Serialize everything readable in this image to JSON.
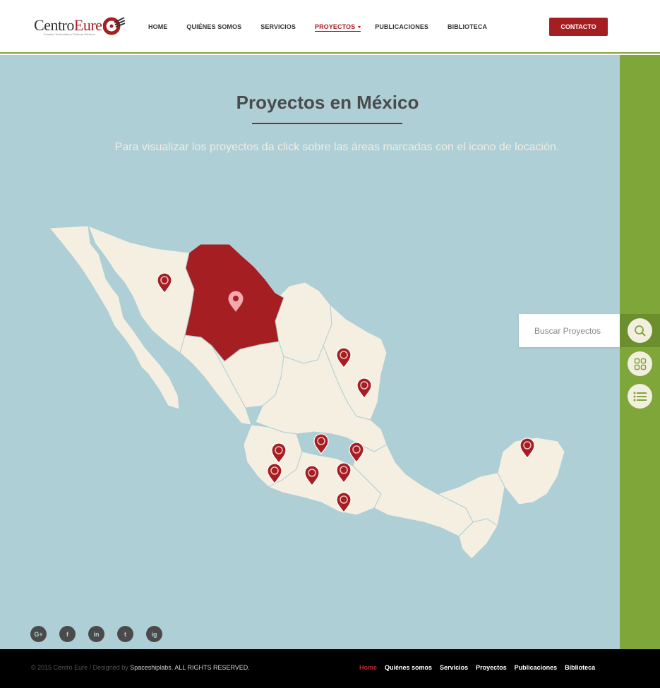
{
  "brand": {
    "logo_main": "Centro",
    "logo_accent": "Eure",
    "logo_tagline": "Estudios Territoriales y Políticas Públicas"
  },
  "nav": {
    "items": [
      "HOME",
      "QUIÉNES SOMOS",
      "SERVICIOS",
      "PROYECTOS",
      "PUBLICACIONES",
      "BIBLIOTECA"
    ],
    "active": "PROYECTOS",
    "contact_label": "CONTACTO"
  },
  "main": {
    "title": "Proyectos en México",
    "subtitle": "Para visualizar  los proyectos da click sobre las áreas marcadas con el icono de locación."
  },
  "search": {
    "placeholder": "Buscar Proyectos"
  },
  "icons": {
    "search": "search-icon",
    "grid": "grid-view-icon",
    "list": "list-view-icon",
    "location": "location-pin-icon"
  },
  "colors": {
    "brand_red": "#a51e22",
    "accent_green": "#7fa638",
    "ocean": "#aecfd6",
    "land": "#f5efe1"
  },
  "social": [
    "G+",
    "f",
    "in",
    "t",
    "ig"
  ],
  "footer": {
    "copyright": "© 2015 Centro Eure  /   Designed by ",
    "designer": "Spaceshiplabs. ALL RIGHTS RESERVED.",
    "links": [
      "Home",
      "Quiénes somos",
      "Servicios",
      "Proyectos",
      "Publicaciones",
      "Biblioteca"
    ]
  }
}
